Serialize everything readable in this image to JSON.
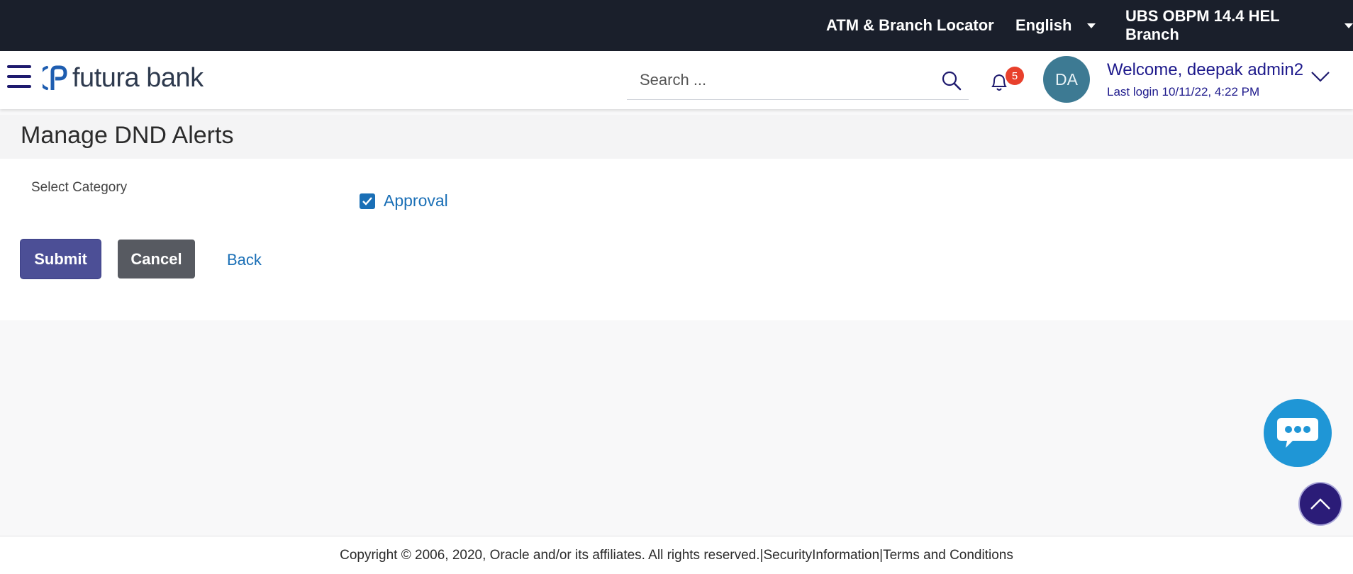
{
  "topbar": {
    "locator": "ATM & Branch Locator",
    "language": "English",
    "branch": "UBS OBPM 14.4 HEL Branch"
  },
  "header": {
    "logo_text": "futura bank",
    "search_placeholder": "Search ...",
    "notification_count": "5",
    "avatar_initials": "DA",
    "welcome": "Welcome, deepak admin2",
    "last_login": "Last login 10/11/22, 4:22 PM"
  },
  "page": {
    "title": "Manage DND Alerts",
    "select_category_label": "Select Category",
    "category_option": "Approval",
    "category_checked": true,
    "submit": "Submit",
    "cancel": "Cancel",
    "back": "Back"
  },
  "footer": {
    "copyright": "Copyright © 2006, 2020, Oracle and/or its affiliates. All rights reserved.",
    "security": "SecurityInformation",
    "terms": "Terms and Conditions"
  },
  "colors": {
    "topbar_bg": "#1a1f2b",
    "brand_text": "#1e1a8c",
    "link": "#1a6fb6",
    "submit_bg": "#4c4f96",
    "cancel_bg": "#575a61",
    "chat_bg": "#1f96d6",
    "scroll_top_bg": "#2b1c78",
    "badge_bg": "#e8402c"
  }
}
